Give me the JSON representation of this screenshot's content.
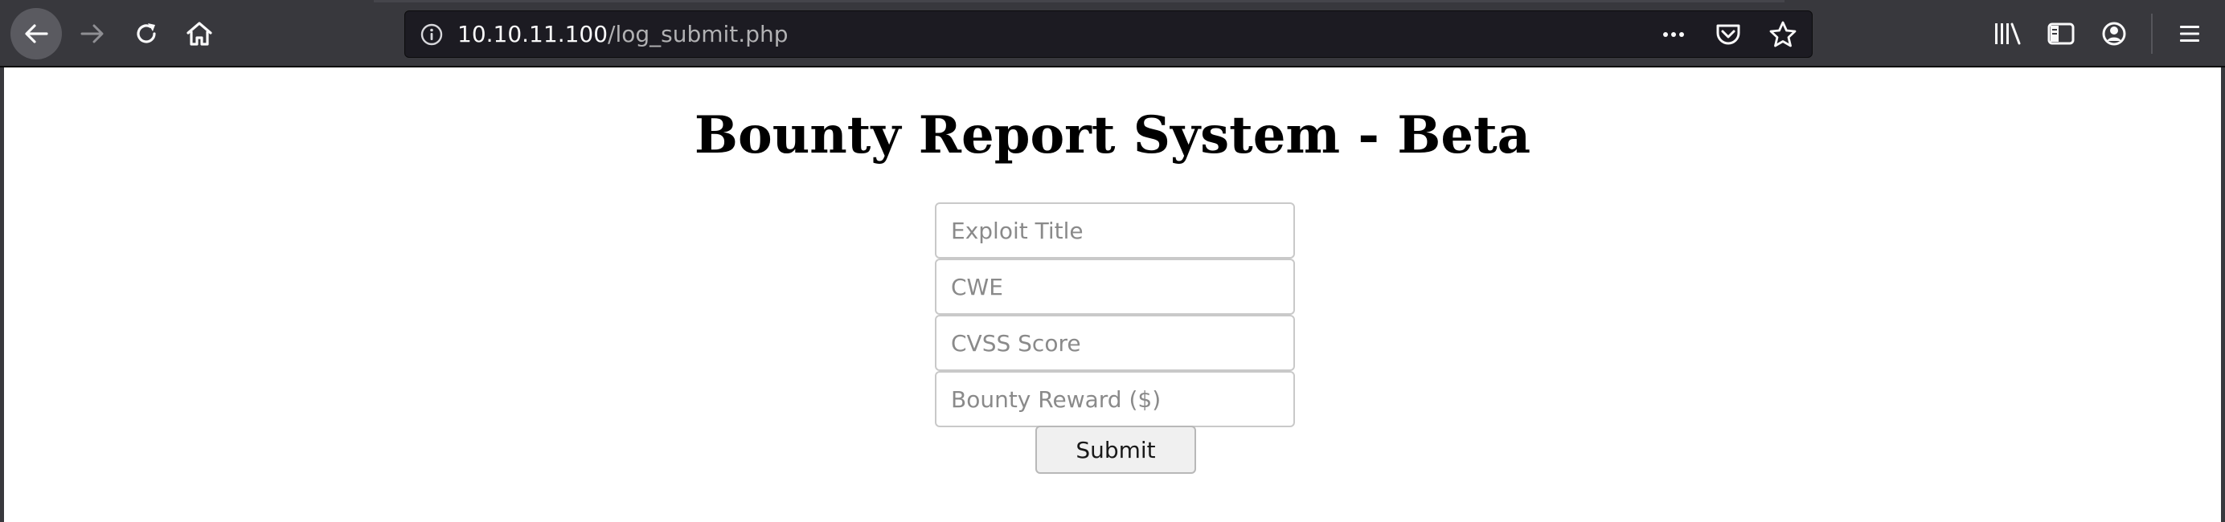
{
  "browser": {
    "url_host": "10.10.11.100",
    "url_path": "/log_submit.php",
    "toolbar_icons": [
      "back-icon",
      "forward-icon",
      "reload-icon",
      "home-icon"
    ],
    "url_icons": [
      "site-info-icon",
      "page-actions-icon",
      "pocket-icon",
      "bookmark-star-icon"
    ],
    "right_icons": [
      "library-icon",
      "sidebar-icon",
      "account-icon",
      "menu-icon"
    ],
    "colors": {
      "toolbar_bg": "#38383d",
      "urlbar_bg": "#1c1b22",
      "back_button_bg": "#5a5a60"
    }
  },
  "page": {
    "title": "Bounty Report System - Beta",
    "form": {
      "fields": [
        {
          "placeholder": "Exploit Title",
          "value": ""
        },
        {
          "placeholder": "CWE",
          "value": ""
        },
        {
          "placeholder": "CVSS Score",
          "value": ""
        },
        {
          "placeholder": "Bounty Reward ($)",
          "value": ""
        }
      ],
      "submit_label": "Submit"
    }
  }
}
